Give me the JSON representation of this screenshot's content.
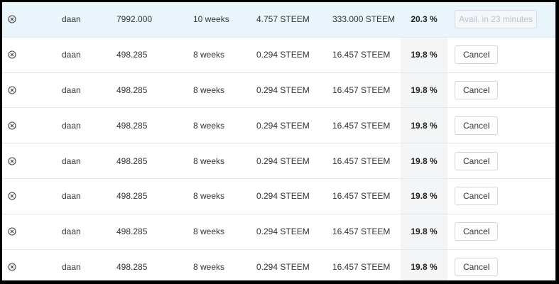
{
  "table": {
    "rows": [
      {
        "name": "daan",
        "amount": "7992.000",
        "duration": "10 weeks",
        "interest": "4.757 STEEM",
        "total": "333.000 STEEM",
        "rate": "20.3 %",
        "action": "Avail. in 23 minutes",
        "action_disabled": true,
        "highlight": true
      },
      {
        "name": "daan",
        "amount": "498.285",
        "duration": "8 weeks",
        "interest": "0.294 STEEM",
        "total": "16.457 STEEM",
        "rate": "19.8 %",
        "action": "Cancel",
        "action_disabled": false,
        "highlight": false
      },
      {
        "name": "daan",
        "amount": "498.285",
        "duration": "8 weeks",
        "interest": "0.294 STEEM",
        "total": "16.457 STEEM",
        "rate": "19.8 %",
        "action": "Cancel",
        "action_disabled": false,
        "highlight": false
      },
      {
        "name": "daan",
        "amount": "498.285",
        "duration": "8 weeks",
        "interest": "0.294 STEEM",
        "total": "16.457 STEEM",
        "rate": "19.8 %",
        "action": "Cancel",
        "action_disabled": false,
        "highlight": false
      },
      {
        "name": "daan",
        "amount": "498.285",
        "duration": "8 weeks",
        "interest": "0.294 STEEM",
        "total": "16.457 STEEM",
        "rate": "19.8 %",
        "action": "Cancel",
        "action_disabled": false,
        "highlight": false
      },
      {
        "name": "daan",
        "amount": "498.285",
        "duration": "8 weeks",
        "interest": "0.294 STEEM",
        "total": "16.457 STEEM",
        "rate": "19.8 %",
        "action": "Cancel",
        "action_disabled": false,
        "highlight": false
      },
      {
        "name": "daan",
        "amount": "498.285",
        "duration": "8 weeks",
        "interest": "0.294 STEEM",
        "total": "16.457 STEEM",
        "rate": "19.8 %",
        "action": "Cancel",
        "action_disabled": false,
        "highlight": false
      },
      {
        "name": "daan",
        "amount": "498.285",
        "duration": "8 weeks",
        "interest": "0.294 STEEM",
        "total": "16.457 STEEM",
        "rate": "19.8 %",
        "action": "Cancel",
        "action_disabled": false,
        "highlight": false
      }
    ],
    "row_icon": "circle-x-icon",
    "colors": {
      "highlight_row": "#e9f4fb",
      "rate_column_bg": "#f4f5f6",
      "disabled_button_text": "#b8c2cb"
    }
  }
}
